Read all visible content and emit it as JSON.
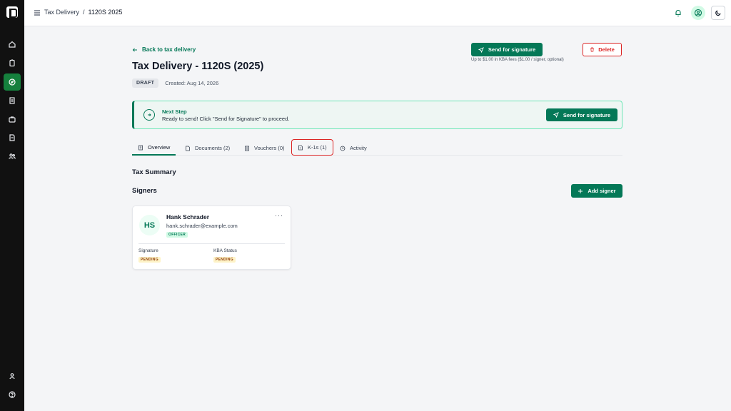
{
  "header": {
    "breadcrumb_parent": "Tax Delivery",
    "breadcrumb_separator": "/",
    "breadcrumb_current": "1120S 2025"
  },
  "nav": {
    "items": [
      "home-icon",
      "clipboard-icon",
      "compass-icon",
      "document-icon",
      "briefcase-icon",
      "file-icon",
      "users-icon"
    ],
    "bottom": [
      "user-icon",
      "help-icon"
    ],
    "active_color": "#15803d"
  },
  "page": {
    "back_label": "Back to tax delivery",
    "title": "Tax Delivery - 1120S (2025)",
    "status": "DRAFT",
    "created": "Created: Aug 14, 2026",
    "send_label": "Send for signature",
    "kba_note": "Up to $1.00 in KBA fees ($1.00 / signer, optional)",
    "delete_label": "Delete"
  },
  "next_step": {
    "title": "Next Step",
    "message": "Ready to send! Click \"Send for Signature\" to proceed.",
    "button_label": "Send for signature"
  },
  "tabs": [
    {
      "label": "Overview",
      "active": true
    },
    {
      "label": "Documents (2)",
      "active": false
    },
    {
      "label": "Vouchers (0)",
      "active": false
    },
    {
      "label": "K-1s (1)",
      "active": false
    },
    {
      "label": "Activity",
      "active": false
    }
  ],
  "sections": {
    "tax_summary": "Tax Summary",
    "signers": "Signers",
    "add_signer": "Add signer"
  },
  "signer": {
    "initials": "HS",
    "name": "Hank Schrader",
    "email": "hank.schrader@example.com",
    "role": "OFFICER",
    "signature_label": "Signature",
    "signature_status": "PENDING",
    "kba_label": "KBA Status",
    "kba_status": "PENDING"
  },
  "colors": {
    "primary": "#047857",
    "danger": "#dc2626",
    "pending_bg": "#fef3c7"
  }
}
